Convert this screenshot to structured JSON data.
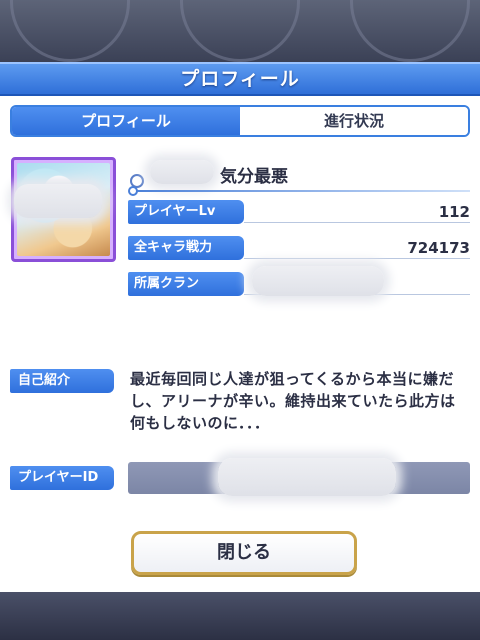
{
  "panel": {
    "title": "プロフィール"
  },
  "tabs": [
    {
      "label": "プロフィール",
      "active": true
    },
    {
      "label": "進行状況",
      "active": false
    }
  ],
  "player": {
    "name_suffix": "気分最悪",
    "stats": [
      {
        "label": "プレイヤーLv",
        "value": "112"
      },
      {
        "label": "全キャラ戦力",
        "value": "724173"
      },
      {
        "label": "所属クラン",
        "value": ""
      }
    ]
  },
  "intro": {
    "label": "自己紹介",
    "text": "最近毎回同じ人達が狙ってくるから本当に嫌だし、アリーナが辛い。維持出来ていたら此方は何もしないのに．．．"
  },
  "player_id": {
    "label": "プレイヤーID"
  },
  "buttons": {
    "close_label": "閉じる"
  },
  "colors": {
    "accent_blue": "#2f70dc",
    "frame_purple": "#8a4fd8",
    "button_gold": "#c9a34a"
  }
}
